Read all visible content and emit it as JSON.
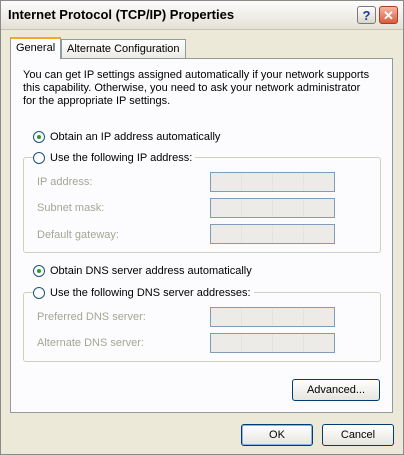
{
  "window": {
    "title": "Internet Protocol (TCP/IP) Properties",
    "help_label": "?",
    "close_label": "✕"
  },
  "tabs": [
    {
      "label": "General",
      "active": true
    },
    {
      "label": "Alternate Configuration",
      "active": false
    }
  ],
  "intro_text": "You can get IP settings assigned automatically if your network supports this capability. Otherwise, you need to ask your network administrator for the appropriate IP settings.",
  "ip": {
    "auto_label": "Obtain an IP address automatically",
    "manual_label": "Use the following IP address:",
    "selected": "auto",
    "fields": [
      {
        "label": "IP address:"
      },
      {
        "label": "Subnet mask:"
      },
      {
        "label": "Default gateway:"
      }
    ]
  },
  "dns": {
    "auto_label": "Obtain DNS server address automatically",
    "manual_label": "Use the following DNS server addresses:",
    "selected": "auto",
    "fields": [
      {
        "label": "Preferred DNS server:"
      },
      {
        "label": "Alternate DNS server:"
      }
    ]
  },
  "buttons": {
    "advanced": "Advanced...",
    "ok": "OK",
    "cancel": "Cancel"
  },
  "colors": {
    "dialog_bg": "#ece9d8",
    "panel_bg": "#fcfcfe",
    "tab_accent": "#f5a72b",
    "radio_dot": "#21a121",
    "disabled_text": "#a5a595"
  }
}
